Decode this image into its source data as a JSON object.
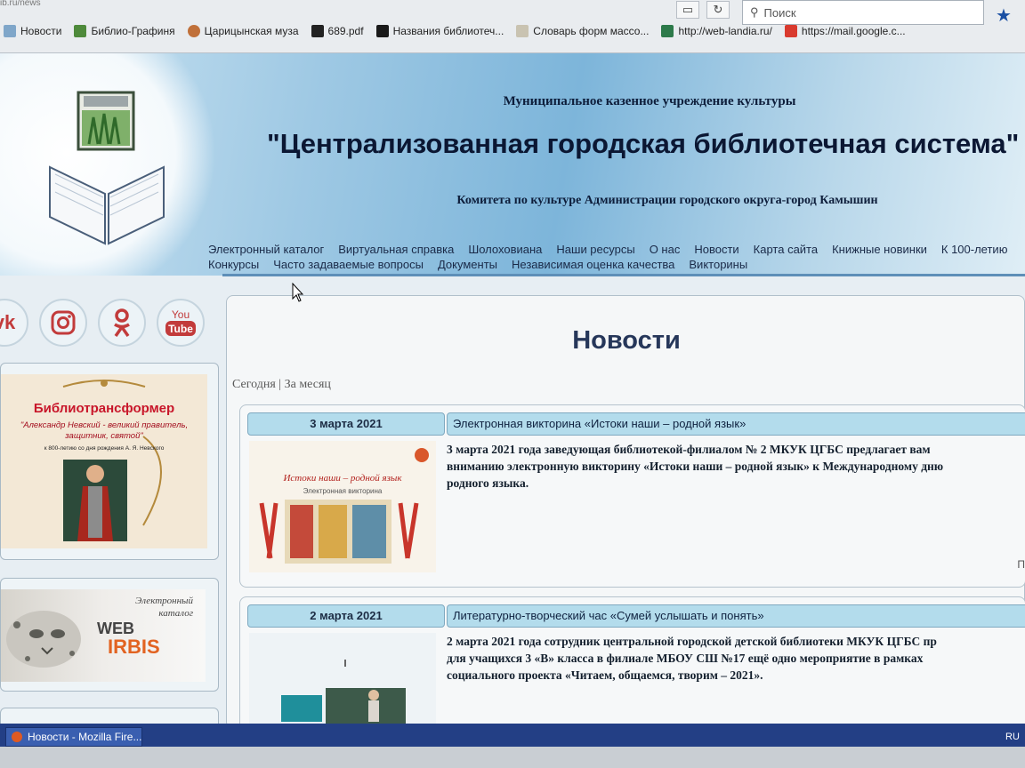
{
  "browser": {
    "search_placeholder": "Поиск",
    "url_fragment": "ib.ru/news",
    "bookmarks": [
      {
        "label": "Новости",
        "icon": "globe-icon"
      },
      {
        "label": "Библио-Графиня",
        "icon": "bookmark-icon"
      },
      {
        "label": "Царицынская муза",
        "icon": "flower-icon"
      },
      {
        "label": "689.pdf",
        "icon": "pdf-icon"
      },
      {
        "label": "Названия библиотеч...",
        "icon": "music-icon"
      },
      {
        "label": "Словарь форм массо...",
        "icon": "book-icon"
      },
      {
        "label": "http://web-landia.ru/",
        "icon": "web-icon"
      },
      {
        "label": "https://mail.google.c...",
        "icon": "mail-icon"
      }
    ]
  },
  "header": {
    "line1": "Муниципальное казенное учреждение культуры",
    "title": "\"Централизованная городская библиотечная система\"",
    "line2": "Комитета по культуре Администрации городского округа-город Камышин",
    "menu_row1": [
      "Электронный каталог",
      "Виртуальная справка",
      "Шолоховиана",
      "Наши ресурсы",
      "О нас",
      "Новости",
      "Карта сайта",
      "Книжные новинки",
      "К 100-летию"
    ],
    "menu_row2": [
      "Конкурсы",
      "Часто задаваемые вопросы",
      "Документы",
      "Независимая оценка качества",
      "Викторины"
    ]
  },
  "sidebar": {
    "socials": [
      {
        "name": "vk",
        "label": "vk"
      },
      {
        "name": "instagram",
        "label": ""
      },
      {
        "name": "odnoklassniki",
        "label": ""
      },
      {
        "name": "youtube",
        "label": "You Tube"
      }
    ],
    "biblio_banner": {
      "title": "Библиотрансформер",
      "subtitle": "\"Александр Невский - великий правитель, защитник, святой\"",
      "note": "к 800-летию со дня рождения А. Я. Невского"
    },
    "irbis_banner": {
      "caption_line1": "Электронный",
      "caption_line2": "каталог",
      "web": "WEB",
      "irbis": "IRBIS"
    }
  },
  "main": {
    "heading": "Новости",
    "filter_today": "Сегодня",
    "filter_sep": " | ",
    "filter_month": "За месяц",
    "news": [
      {
        "date": "3 марта 2021",
        "title": "Электронная  викторина «Истоки наши – родной язык»",
        "text": [
          "3 марта 2021 года  заведующая библиотекой-филиалом № 2  МКУК ЦГБС  предлагает вам",
          "вниманию электронную викторину «Истоки наши – родной язык» к Международному дню",
          "родного языка."
        ],
        "more": "П"
      },
      {
        "date": "2 марта 2021",
        "title": "Литературно-творческий час «Сумей услышать и понять»",
        "text": [
          "2 марта  2021 года   сотрудник центральной городской детской библиотеки МКУК ЦГБС  пр",
          "для учащихся   3  «В»  класса  в филиале МБОУ СШ №17 ещё одно мероприятие в рамках",
          "социального проекта «Читаем, общаемся, творим – 2021»."
        ]
      }
    ],
    "thumb1_text": {
      "top": "Истоки наши – родной язык",
      "sub": "Электронная викторина"
    }
  },
  "taskbar": {
    "window_label": "Новости - Mozilla Fire...",
    "tray": "RU"
  },
  "colors": {
    "accent": "#b3dcec",
    "heading": "#26375a",
    "header_bg": "#7db5da",
    "taskbar": "#233f85"
  }
}
